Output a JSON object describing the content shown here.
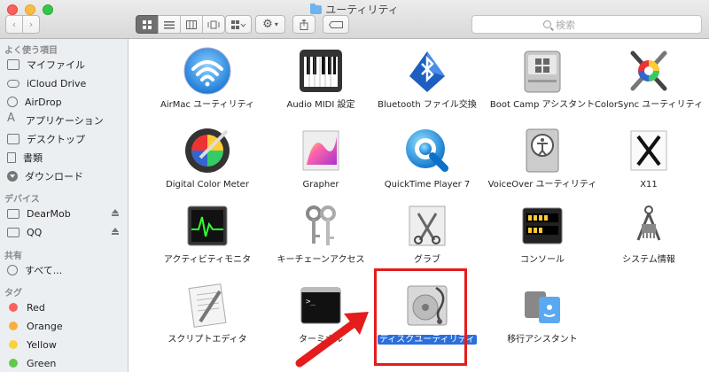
{
  "window": {
    "title": "ユーティリティ",
    "search_placeholder": "検索"
  },
  "sidebar": {
    "favorites_header": "よく使う項目",
    "favorites": [
      {
        "label": "マイファイル",
        "icon": "all-files-icon"
      },
      {
        "label": "iCloud Drive",
        "icon": "cloud-icon"
      },
      {
        "label": "AirDrop",
        "icon": "airdrop-icon"
      },
      {
        "label": "アプリケーション",
        "icon": "applications-icon"
      },
      {
        "label": "デスクトップ",
        "icon": "desktop-icon"
      },
      {
        "label": "書類",
        "icon": "documents-icon"
      },
      {
        "label": "ダウンロード",
        "icon": "downloads-icon"
      }
    ],
    "devices_header": "デバイス",
    "devices": [
      {
        "label": "DearMob"
      },
      {
        "label": "QQ"
      }
    ],
    "shared_header": "共有",
    "shared": [
      {
        "label": "すべて..."
      }
    ],
    "tags_header": "タグ",
    "tags": [
      {
        "label": "Red",
        "color": "#fc605c"
      },
      {
        "label": "Orange",
        "color": "#fdae42"
      },
      {
        "label": "Yellow",
        "color": "#f8d33f"
      },
      {
        "label": "Green",
        "color": "#5fca4a"
      }
    ]
  },
  "apps": [
    {
      "label": "AirMac ユーティリティ",
      "icon": "airmac-icon"
    },
    {
      "label": "Audio MIDI 設定",
      "icon": "midi-keyboard-icon"
    },
    {
      "label": "Bluetooth ファイル交換",
      "icon": "bluetooth-icon"
    },
    {
      "label": "Boot Camp アシスタント",
      "icon": "bootcamp-icon"
    },
    {
      "label": "ColorSync ユーティリティ",
      "icon": "colorsync-icon"
    },
    {
      "label": "Digital Color Meter",
      "icon": "color-meter-icon"
    },
    {
      "label": "Grapher",
      "icon": "grapher-icon"
    },
    {
      "label": "QuickTime Player 7",
      "icon": "quicktime-icon"
    },
    {
      "label": "VoiceOver ユーティリティ",
      "icon": "voiceover-icon"
    },
    {
      "label": "X11",
      "icon": "x11-icon"
    },
    {
      "label": "アクティビティモニタ",
      "icon": "activity-monitor-icon"
    },
    {
      "label": "キーチェーンアクセス",
      "icon": "keychain-icon"
    },
    {
      "label": "グラブ",
      "icon": "grab-icon"
    },
    {
      "label": "コンソール",
      "icon": "console-icon"
    },
    {
      "label": "システム情報",
      "icon": "system-info-icon"
    },
    {
      "label": "スクリプトエディタ",
      "icon": "script-editor-icon"
    },
    {
      "label": "ターミナル",
      "icon": "terminal-icon"
    },
    {
      "label": "ディスクユーティリティ",
      "icon": "disk-utility-icon",
      "selected": true
    },
    {
      "label": "移行アシスタント",
      "icon": "migration-icon"
    }
  ]
}
